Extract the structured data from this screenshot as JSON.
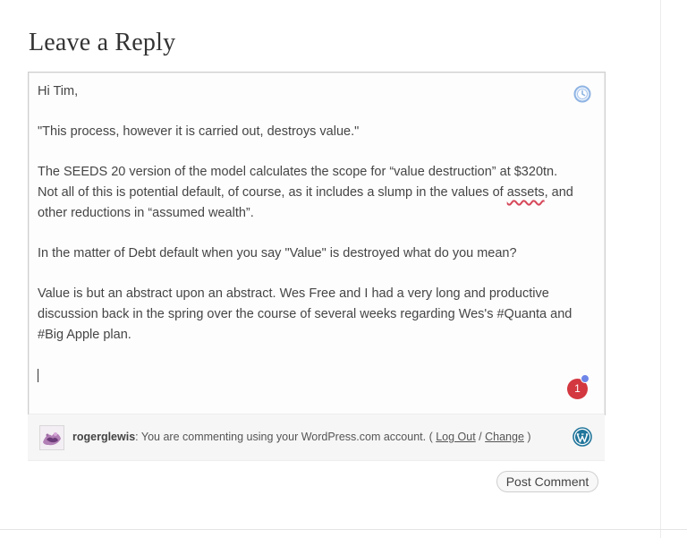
{
  "reply": {
    "heading": "Leave a Reply"
  },
  "comment": {
    "paragraphs": [
      "Hi Tim,",
      "\"This process, however it is carried out, destroys value.\""
    ],
    "p3_before": "The SEEDS 20 version of the model calculates the scope for “value destruction” at $320tn. Not all of this is potential default, of course, as it includes a slump in the values of ",
    "p3_misspelled": "assets",
    "p3_after": ", and other reductions in “assumed wealth”.",
    "p4": "In the matter of Debt default when you say \"Value\" is destroyed what do you mean?",
    "p5": "Value is but an abstract upon an abstract. Wes Free and I had a very long and productive discussion back in the spring over the course of several weeks regarding Wes's #Quanta and #Big Apple plan.",
    "badge_count": "1",
    "icons": {
      "clock": "clock-icon",
      "badge": "notification-badge"
    }
  },
  "identity": {
    "username": "rogerglewis",
    "message_prefix": ": You are commenting using your WordPress.com account. ( ",
    "logout_label": "Log Out",
    "separator": " /  ",
    "change_label": "Change",
    "message_suffix": " )",
    "icons": {
      "avatar": "avatar",
      "brand": "wordpress-icon"
    }
  },
  "actions": {
    "post_comment_label": "Post Comment"
  },
  "colors": {
    "badge": "#d3373f",
    "badge_dot": "#6e86e8",
    "spellcheck_underline": "#d6485a",
    "wordpress_blue": "#21759b",
    "clock_blue": "#8fb4e3"
  }
}
